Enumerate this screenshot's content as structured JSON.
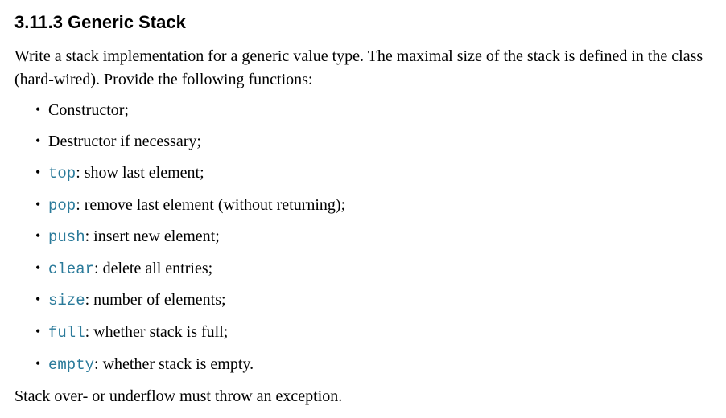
{
  "heading": "3.11.3 Generic Stack",
  "intro": "Write a stack implementation for a generic value type. The maximal size of the stack is defined in the class (hard-wired). Provide the following functions:",
  "items": [
    {
      "code": null,
      "text": "Constructor;"
    },
    {
      "code": null,
      "text": "Destructor if necessary;"
    },
    {
      "code": "top",
      "text": ": show last element;"
    },
    {
      "code": "pop",
      "text": ": remove last element (without returning);"
    },
    {
      "code": "push",
      "text": ": insert new element;"
    },
    {
      "code": "clear",
      "text": ": delete all entries;"
    },
    {
      "code": "size",
      "text": ": number of elements;"
    },
    {
      "code": "full",
      "text": ": whether stack is full;"
    },
    {
      "code": "empty",
      "text": ": whether stack is empty."
    }
  ],
  "outro": "Stack over- or underflow must throw an exception."
}
